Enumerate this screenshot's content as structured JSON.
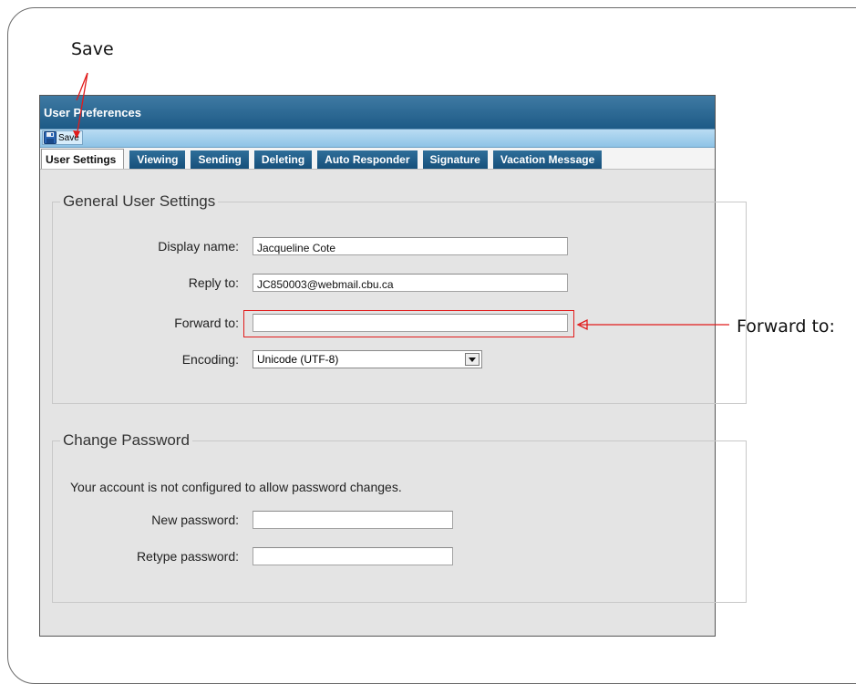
{
  "annotations": {
    "save_callout": "Save",
    "forward_callout": "Forward to:"
  },
  "window": {
    "title": "User Preferences"
  },
  "toolbar": {
    "save_label": "Save",
    "save_icon": "floppy-disk-icon"
  },
  "tabs": [
    {
      "label": "User Settings",
      "active": true
    },
    {
      "label": "Viewing",
      "active": false
    },
    {
      "label": "Sending",
      "active": false
    },
    {
      "label": "Deleting",
      "active": false
    },
    {
      "label": "Auto Responder",
      "active": false
    },
    {
      "label": "Signature",
      "active": false
    },
    {
      "label": "Vacation Message",
      "active": false
    }
  ],
  "general": {
    "legend": "General User Settings",
    "display_name": {
      "label": "Display name:",
      "value": "Jacqueline Cote"
    },
    "reply_to": {
      "label": "Reply to:",
      "value": "JC850003@webmail.cbu.ca"
    },
    "forward_to": {
      "label": "Forward to:",
      "value": ""
    },
    "encoding": {
      "label": "Encoding:",
      "value": "Unicode (UTF-8)"
    }
  },
  "password": {
    "legend": "Change Password",
    "notice": "Your account is not configured to allow password changes.",
    "new_label": "New password:",
    "retype_label": "Retype password:"
  },
  "colors": {
    "titlebar": "#1d5a86",
    "toolbar": "#8ec3e6",
    "tab": "#16507b",
    "highlight": "#e11b1b"
  }
}
